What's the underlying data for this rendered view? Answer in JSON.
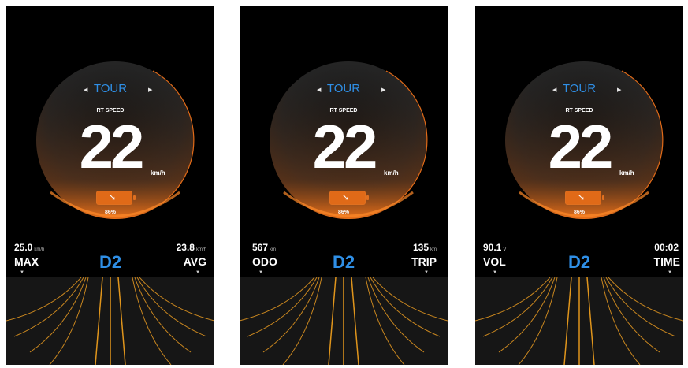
{
  "screens": [
    {
      "mode": "TOUR",
      "rt_label": "RT SPEED",
      "speed": "22",
      "unit": "km/h",
      "battery_pct": "86%",
      "gear": "D2",
      "left": {
        "value": "25.0",
        "unit": "km/h",
        "label": "MAX"
      },
      "right": {
        "value": "23.8",
        "unit": "km/h",
        "label": "AVG"
      }
    },
    {
      "mode": "TOUR",
      "rt_label": "RT SPEED",
      "speed": "22",
      "unit": "km/h",
      "battery_pct": "86%",
      "gear": "D2",
      "left": {
        "value": "567",
        "unit": "km",
        "label": "ODO"
      },
      "right": {
        "value": "135",
        "unit": "km",
        "label": "TRIP"
      }
    },
    {
      "mode": "TOUR",
      "rt_label": "RT SPEED",
      "speed": "22",
      "unit": "km/h",
      "battery_pct": "86%",
      "gear": "D2",
      "left": {
        "value": "90.1",
        "unit": "V",
        "label": "VOL"
      },
      "right": {
        "value": "00:02",
        "unit": "",
        "label": "TIME"
      }
    }
  ],
  "colors": {
    "accent_blue": "#2f8fe6",
    "accent_orange": "#e06a18",
    "background": "#000000"
  },
  "icons": {
    "mode_prev": "left-triangle-icon",
    "mode_next": "right-triangle-icon",
    "battery": "charging-battery-icon",
    "stat_menu": "caret-down-icon"
  }
}
